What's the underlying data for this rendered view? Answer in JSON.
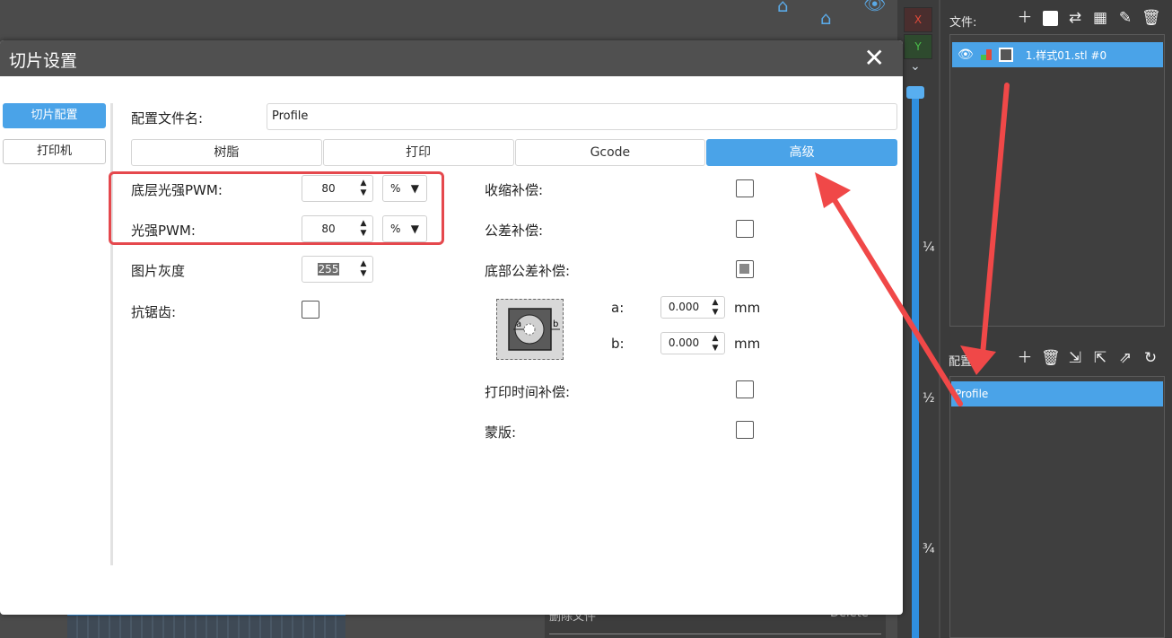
{
  "background": {
    "bottom_panel": {
      "left_text": "删除文件",
      "right_text": "Delete"
    },
    "icons": [
      "home-icon",
      "eye-icon"
    ]
  },
  "axis": {
    "x_label": "X",
    "y_label": "Y",
    "ticks": [
      "¼",
      "½",
      "¾"
    ]
  },
  "right_panel": {
    "files_label": "文件:",
    "file_item": "1.样式01.stl #0",
    "config_label": "配置",
    "profile_item": "Profile"
  },
  "dialog": {
    "title": "切片设置",
    "close": "✕",
    "sidebar": [
      "切片配置",
      "打印机"
    ],
    "profile_name_label": "配置文件名:",
    "profile_name_value": "Profile",
    "tabs": [
      "树脂",
      "打印",
      "Gcode",
      "高级"
    ],
    "active_tab": "高级",
    "left": {
      "bottom_pwm_label": "底层光强PWM:",
      "bottom_pwm_value": "80",
      "bottom_pwm_unit": "%",
      "pwm_label": "光强PWM:",
      "pwm_value": "80",
      "pwm_unit": "%",
      "gray_label": "图片灰度",
      "gray_value": "255",
      "antialias_label": "抗锯齿:"
    },
    "right": {
      "shrink_label": "收缩补偿:",
      "tolerance_label": "公差补偿:",
      "bottom_tolerance_label": "底部公差补偿:",
      "a_label": "a:",
      "a_value": "0.000",
      "b_label": "b:",
      "b_value": "0.000",
      "unit": "mm",
      "diagram_a": "a",
      "diagram_b": "b",
      "print_time_label": "打印时间补偿:",
      "mask_label": "蒙版:"
    }
  }
}
